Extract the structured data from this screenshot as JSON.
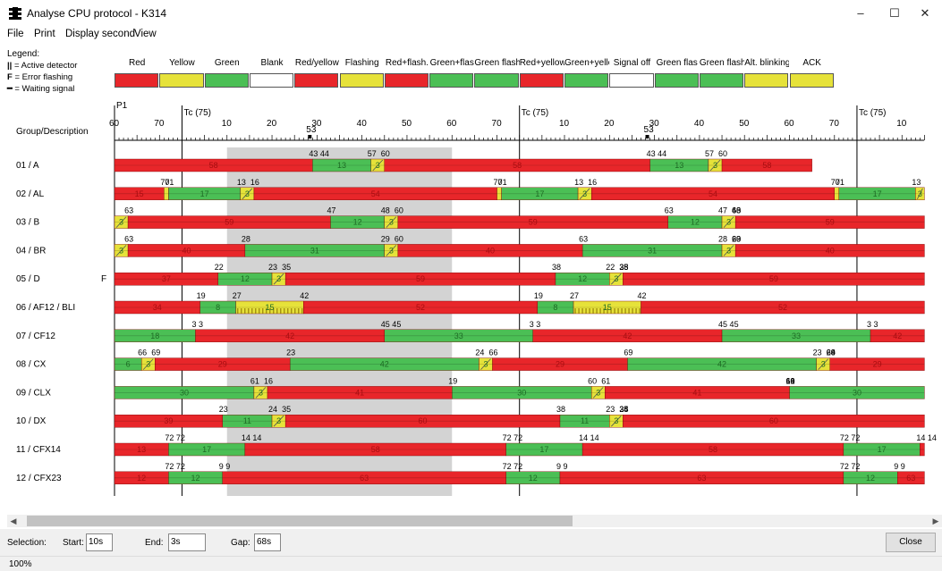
{
  "window": {
    "title": "Analyse CPU protocol - K314",
    "minimize": "–",
    "maximize": "☐",
    "close": "✕"
  },
  "menu": [
    "File",
    "Print",
    "Display second",
    "View"
  ],
  "legend": {
    "title": "Legend:",
    "notes": [
      {
        "symbol": "||",
        "text": "= Active detector"
      },
      {
        "symbol": "F",
        "text": "= Error flashing"
      },
      {
        "symbol": "━",
        "text": "= Waiting signal"
      }
    ],
    "items": [
      "Red",
      "Yellow",
      "Green",
      "Blank",
      "Red/yellow",
      "Flashing",
      "Red+flash.",
      "Green+flas",
      "Green flash.+yello",
      "Red+yellow",
      "Green+yellow",
      "Signal off",
      "Green flas",
      "Green flash.+flash",
      "Alt. blinking",
      "ACK"
    ]
  },
  "colors": {
    "red": "#e8262a",
    "green": "#4bbf55",
    "yellow": "#e6e23a",
    "gray": "#d3d3d3"
  },
  "axis": {
    "header_label": "Group/Description",
    "p1_label": "P1",
    "cycle_label": "Tc (75)",
    "marker_label": "53",
    "ticks_segment1": [
      "60",
      "70"
    ],
    "ticks_segment": [
      "10",
      "20",
      "30",
      "40",
      "50",
      "60",
      "70"
    ],
    "ticks_last": [
      "10"
    ]
  },
  "groups": [
    {
      "name": "01 / A",
      "flag": "",
      "labels": [
        "43 44",
        "57",
        "60",
        "43 44",
        "57",
        "60"
      ],
      "segs": [
        [
          "R",
          0,
          44,
          "58"
        ],
        [
          "G",
          44,
          57,
          "13"
        ],
        [
          "Y",
          57,
          60,
          "3"
        ],
        [
          "R",
          60,
          119,
          "58"
        ],
        [
          "G",
          119,
          132,
          "13"
        ],
        [
          "Y",
          132,
          135,
          "3"
        ],
        [
          "R",
          135,
          155,
          "58"
        ]
      ]
    },
    {
      "name": "02 / AL",
      "flag": "",
      "labels": [
        "70",
        "71",
        "13",
        "16",
        "70",
        "71",
        "13",
        "16",
        "70",
        "71",
        "13"
      ],
      "segs": [
        [
          "R",
          0,
          11,
          "15"
        ],
        [
          "Y",
          11,
          12,
          ""
        ],
        [
          "G",
          12,
          28,
          "17"
        ],
        [
          "Y",
          28,
          31,
          "3"
        ],
        [
          "R",
          31,
          85,
          "54"
        ],
        [
          "Y",
          85,
          86,
          ""
        ],
        [
          "G",
          86,
          103,
          "17"
        ],
        [
          "Y",
          103,
          106,
          "3"
        ],
        [
          "R",
          106,
          160,
          "54"
        ],
        [
          "Y",
          160,
          161,
          ""
        ],
        [
          "G",
          161,
          178,
          "17"
        ],
        [
          "Y",
          178,
          180,
          "3"
        ]
      ]
    },
    {
      "name": "03 / B",
      "flag": "",
      "labels": [
        "63",
        "47",
        "48",
        "60",
        "63",
        "47",
        "48",
        "60",
        "63"
      ],
      "segs": [
        [
          "Y",
          0,
          3,
          "3"
        ],
        [
          "R",
          3,
          48,
          "59"
        ],
        [
          "G",
          48,
          60,
          "12"
        ],
        [
          "Y",
          60,
          63,
          "3"
        ],
        [
          "R",
          63,
          123,
          "59"
        ],
        [
          "G",
          123,
          135,
          "12"
        ],
        [
          "Y",
          135,
          138,
          "3"
        ],
        [
          "R",
          138,
          180,
          "59"
        ]
      ]
    },
    {
      "name": "04 / BR",
      "flag": "",
      "labels": [
        "63",
        "28",
        "29",
        "60",
        "63",
        "28",
        "29",
        "60",
        "63"
      ],
      "segs": [
        [
          "Y",
          0,
          3,
          "3"
        ],
        [
          "R",
          3,
          29,
          "40"
        ],
        [
          "G",
          29,
          60,
          "31"
        ],
        [
          "Y",
          60,
          63,
          "3"
        ],
        [
          "R",
          63,
          104,
          "40"
        ],
        [
          "G",
          104,
          135,
          "31"
        ],
        [
          "Y",
          135,
          138,
          "3"
        ],
        [
          "R",
          138,
          180,
          "40"
        ]
      ]
    },
    {
      "name": "05 / D",
      "flag": "F",
      "labels": [
        "22",
        "23",
        "35",
        "38",
        "22",
        "23",
        "35",
        "38"
      ],
      "segs": [
        [
          "R",
          0,
          23,
          "37"
        ],
        [
          "G",
          23,
          35,
          "12"
        ],
        [
          "Y",
          35,
          38,
          "3"
        ],
        [
          "R",
          38,
          98,
          "59"
        ],
        [
          "G",
          98,
          110,
          "12"
        ],
        [
          "Y",
          110,
          113,
          "3"
        ],
        [
          "R",
          113,
          180,
          "59"
        ]
      ]
    },
    {
      "name": "06 / AF12 / BLI",
      "flag": "",
      "labels": [
        "19",
        "27",
        "42",
        "19",
        "27",
        "42"
      ],
      "segs": [
        [
          "R",
          0,
          19,
          "34"
        ],
        [
          "G",
          19,
          27,
          "8"
        ],
        [
          "F",
          27,
          42,
          "15"
        ],
        [
          "R",
          42,
          94,
          "52"
        ],
        [
          "G",
          94,
          102,
          "8"
        ],
        [
          "F",
          102,
          117,
          "15"
        ],
        [
          "R",
          117,
          180,
          "52"
        ]
      ]
    },
    {
      "name": "07 / CF12",
      "flag": "",
      "labels": [
        "3 3",
        "45 45",
        "3 3",
        "45 45",
        "3 3"
      ],
      "segs": [
        [
          "G",
          0,
          18,
          "18"
        ],
        [
          "R",
          18,
          60,
          "42"
        ],
        [
          "G",
          60,
          93,
          "33"
        ],
        [
          "R",
          93,
          135,
          "42"
        ],
        [
          "G",
          135,
          168,
          "33"
        ],
        [
          "R",
          168,
          180,
          "42"
        ]
      ]
    },
    {
      "name": "08 / CX",
      "flag": "",
      "labels": [
        "66",
        "69",
        "23",
        "24",
        "66",
        "69",
        "23",
        "24",
        "66",
        "69"
      ],
      "segs": [
        [
          "G",
          0,
          6,
          "6"
        ],
        [
          "Y",
          6,
          9,
          "3"
        ],
        [
          "R",
          9,
          39,
          "29"
        ],
        [
          "G",
          39,
          81,
          "42"
        ],
        [
          "Y",
          81,
          84,
          "3"
        ],
        [
          "R",
          84,
          114,
          "29"
        ],
        [
          "G",
          114,
          156,
          "42"
        ],
        [
          "Y",
          156,
          159,
          "3"
        ],
        [
          "R",
          159,
          180,
          "29"
        ]
      ]
    },
    {
      "name": "09 / CLX",
      "flag": "",
      "labels": [
        "61",
        "16",
        "19",
        "60",
        "61",
        "16",
        "19",
        "60",
        "61"
      ],
      "segs": [
        [
          "G",
          0,
          31,
          "30"
        ],
        [
          "Y",
          31,
          34,
          "3"
        ],
        [
          "R",
          34,
          75,
          "41"
        ],
        [
          "G",
          75,
          106,
          "30"
        ],
        [
          "Y",
          106,
          109,
          "3"
        ],
        [
          "R",
          109,
          150,
          "41"
        ],
        [
          "G",
          150,
          180,
          "30"
        ]
      ]
    },
    {
      "name": "10 / DX",
      "flag": "",
      "labels": [
        "23",
        "24",
        "35",
        "38",
        "23",
        "24",
        "35",
        "38"
      ],
      "segs": [
        [
          "R",
          0,
          24,
          "39"
        ],
        [
          "G",
          24,
          35,
          "11"
        ],
        [
          "Y",
          35,
          38,
          "3"
        ],
        [
          "R",
          38,
          99,
          "60"
        ],
        [
          "G",
          99,
          110,
          "11"
        ],
        [
          "Y",
          110,
          113,
          "3"
        ],
        [
          "R",
          113,
          180,
          "60"
        ]
      ]
    },
    {
      "name": "11 / CFX14",
      "flag": "",
      "labels": [
        "72 72",
        "14 14",
        "72 72",
        "14 14",
        "72 72",
        "14 14"
      ],
      "segs": [
        [
          "R",
          0,
          12,
          "13"
        ],
        [
          "G",
          12,
          29,
          "17"
        ],
        [
          "R",
          29,
          87,
          "58"
        ],
        [
          "G",
          87,
          104,
          "17"
        ],
        [
          "R",
          104,
          162,
          "58"
        ],
        [
          "G",
          162,
          179,
          "17"
        ],
        [
          "R",
          179,
          180,
          ""
        ]
      ]
    },
    {
      "name": "12 / CFX23",
      "flag": "",
      "labels": [
        "72 72",
        "9 9",
        "72 72",
        "9 9",
        "72 72",
        "9 9"
      ],
      "segs": [
        [
          "R",
          0,
          12,
          "12"
        ],
        [
          "G",
          12,
          24,
          "12"
        ],
        [
          "R",
          24,
          87,
          "63"
        ],
        [
          "G",
          87,
          99,
          "12"
        ],
        [
          "R",
          99,
          162,
          "63"
        ],
        [
          "G",
          162,
          174,
          "12"
        ],
        [
          "R",
          174,
          180,
          "63"
        ]
      ]
    }
  ],
  "selection": {
    "label": "Selection:",
    "start_label": "Start:",
    "start": "10s",
    "end_label": "End:",
    "end": "3s",
    "gap_label": "Gap:",
    "gap": "68s"
  },
  "close_button": "Close",
  "zoom": "100%"
}
